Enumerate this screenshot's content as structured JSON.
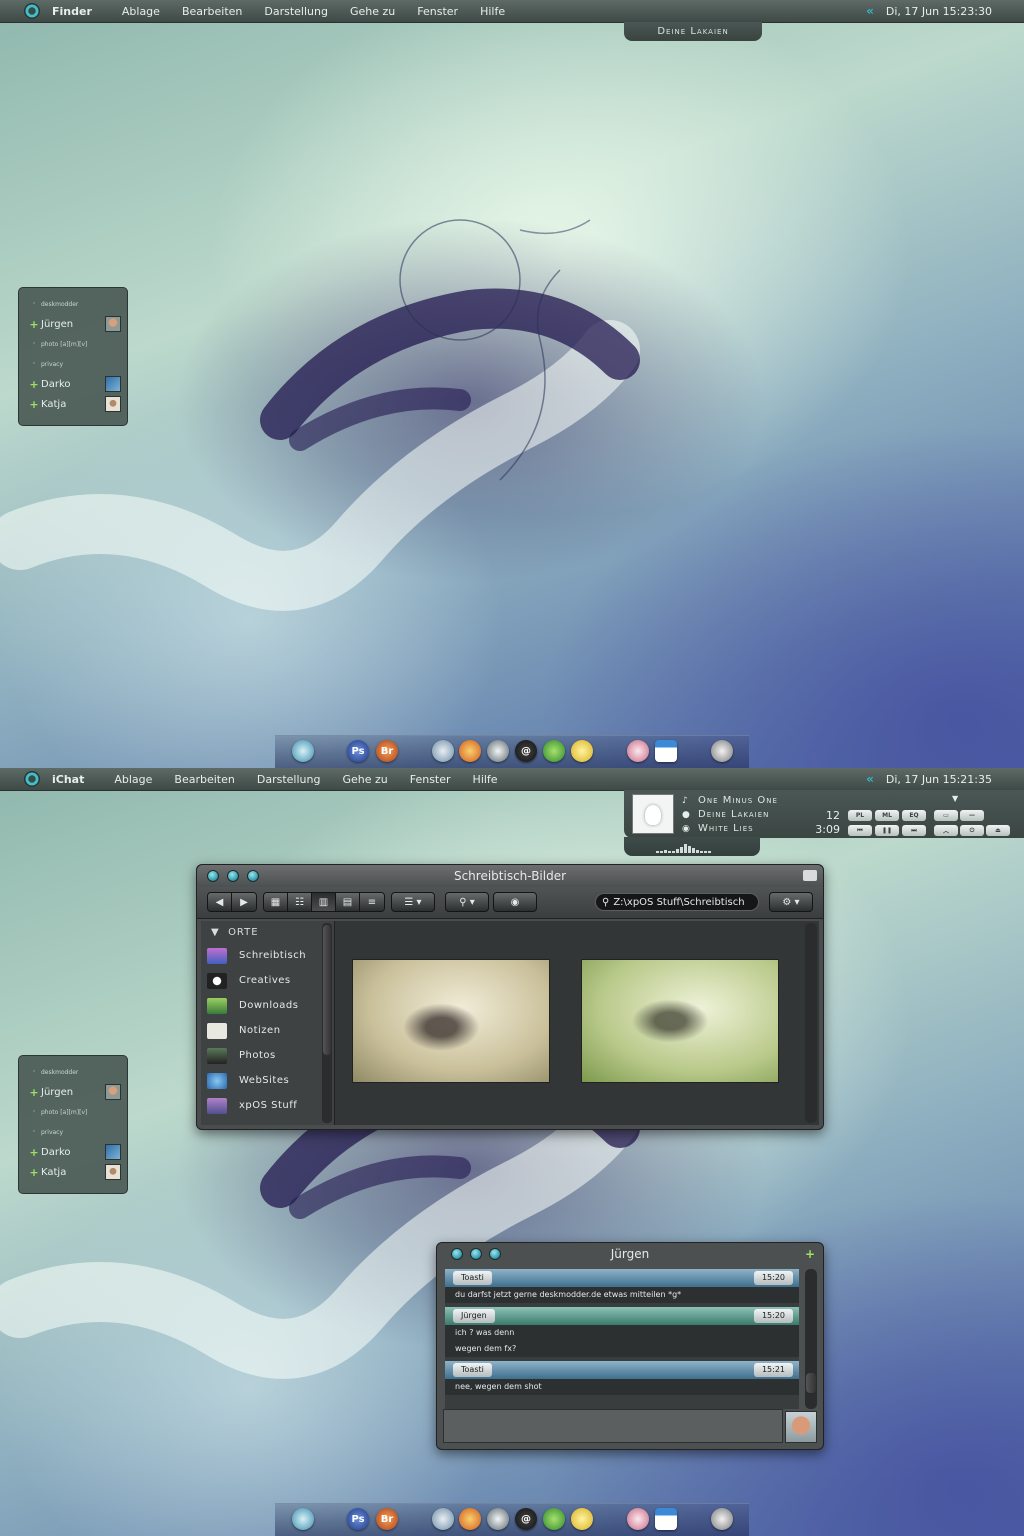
{
  "colors": {
    "accent": "#3fc0c8",
    "menubar": "#4b5754",
    "plus_green": "#9ee060"
  },
  "screen1": {
    "menubar": {
      "app": "Finder",
      "items": [
        "Ablage",
        "Bearbeiten",
        "Darstellung",
        "Gehe zu",
        "Fenster",
        "Hilfe"
      ],
      "clock": "Di, 17 Jun 15:23:30"
    },
    "now_playing_tab": "Deine Lakaien"
  },
  "screen2": {
    "menubar": {
      "app": "iChat",
      "items": [
        "Ablage",
        "Bearbeiten",
        "Darstellung",
        "Gehe zu",
        "Fenster",
        "Hilfe"
      ],
      "clock": "Di, 17 Jun 15:21:35"
    },
    "music": {
      "title": "One Minus One",
      "artist": "Deine Lakaien",
      "album": "White Lies",
      "track_number": "12",
      "time": "3:09",
      "buttons_top": [
        "PL",
        "ML",
        "EQ"
      ],
      "icons": [
        "note-icon",
        "person-icon",
        "disc-icon"
      ]
    },
    "finder": {
      "title": "Schreibtisch-Bilder",
      "search_value": "Z:\\xpOS Stuff\\Schreibtisch",
      "sidebar_header": "ORTE",
      "places": [
        "Schreibtisch",
        "Creatives",
        "Downloads",
        "Notizen",
        "Photos",
        "WebSites",
        "xpOS Stuff"
      ]
    },
    "chat": {
      "title": "Jürgen",
      "messages": [
        {
          "from": "Toasti",
          "time": "15:20",
          "lines": [
            "du darfst jetzt gerne deskmodder.de etwas mitteilen *g*"
          ]
        },
        {
          "from": "Jürgen",
          "time": "15:20",
          "lines": [
            "ich ? was denn",
            "wegen dem fx?"
          ]
        },
        {
          "from": "Toasti",
          "time": "15:21",
          "lines": [
            "nee, wegen dem shot"
          ]
        }
      ]
    }
  },
  "buddies": {
    "rows": [
      {
        "name": "deskmodder",
        "type": "group"
      },
      {
        "name": "Jürgen",
        "type": "buddy"
      },
      {
        "name": "photo [a][m][v]",
        "type": "group"
      },
      {
        "name": "privacy",
        "type": "group"
      },
      {
        "name": "Darko",
        "type": "buddy"
      },
      {
        "name": "Katja",
        "type": "buddy"
      }
    ]
  },
  "dock": {
    "icons": [
      "finder-icon",
      "photoshop-icon",
      "bridge-icon",
      "mail-icon",
      "firefox-icon",
      "adium-icon",
      "at-mail-icon",
      "ichat-icon",
      "notes-icon",
      "itunes-icon",
      "calendar-icon",
      "trash-icon"
    ],
    "labels": {
      "photoshop": "Ps",
      "bridge": "Br",
      "at": "@"
    }
  }
}
